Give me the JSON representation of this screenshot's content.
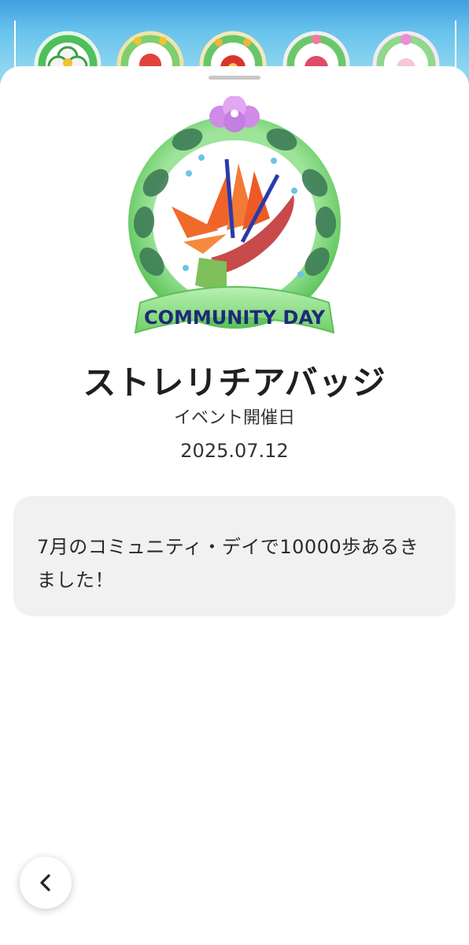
{
  "badge": {
    "title": "ストレリチアバッジ",
    "ribbon_text": "COMMUNITY DAY",
    "event_label": "イベント開催日",
    "event_date": "2025.07.12",
    "description": "7月のコミュニティ・デイで10000歩あるきました！"
  },
  "navigation": {
    "back_icon": "chevron-left-icon"
  },
  "colors": {
    "wreath_green": "#6fd06a",
    "ribbon_green": "#8fe08a",
    "ribbon_text": "#1e2a78",
    "flower_orange": "#f0642a",
    "flower_purple": "#d08ae8",
    "sheet_background": "#ffffff",
    "description_background": "#f1f1f1",
    "sky_blue": "#6ec6ee"
  }
}
